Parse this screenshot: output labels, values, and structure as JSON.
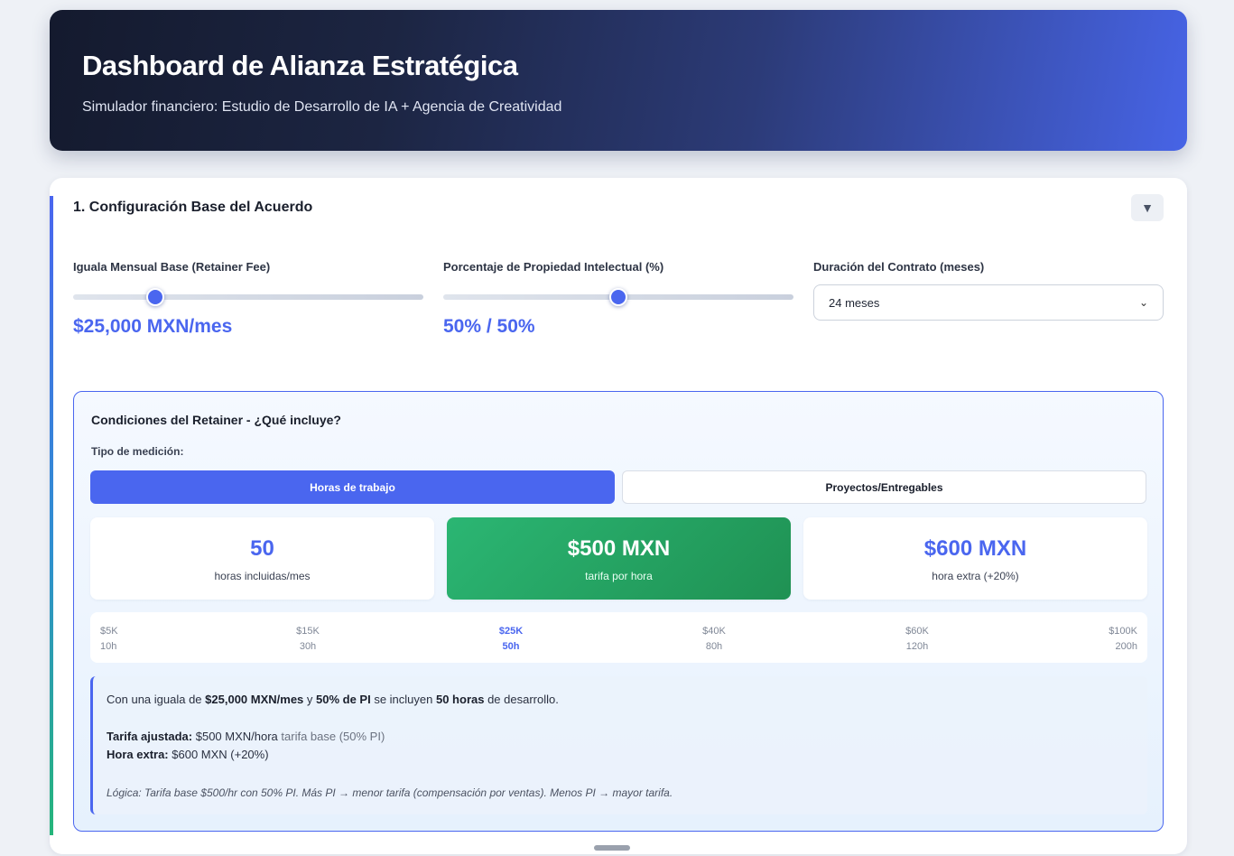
{
  "header": {
    "title": "Dashboard de Alianza Estratégica",
    "subtitle": "Simulador financiero: Estudio de Desarrollo de IA + Agencia de Creatividad"
  },
  "section": {
    "title": "1. Configuración Base del Acuerdo",
    "toggle_icon": "▼",
    "toggle": "collapse-toggle-icon"
  },
  "retainer": {
    "label": "Iguala Mensual Base (Retainer Fee)",
    "value": "$25,000 MXN/mes",
    "slider_fraction": 0.22
  },
  "ip": {
    "label": "Porcentaje de Propiedad Intelectual (%)",
    "value": "50% / 50%",
    "slider_fraction": 0.5
  },
  "duration": {
    "label": "Duración del Contrato (meses)",
    "selected": "24 meses",
    "chevron": "⌄"
  },
  "conditions": {
    "title": "Condiciones del Retainer - ¿Qué incluye?",
    "measure_label": "Tipo de medición:",
    "tabs": [
      {
        "label": "Horas de trabajo",
        "active": true
      },
      {
        "label": "Proyectos/Entregables",
        "active": false
      }
    ],
    "stats": [
      {
        "value": "50",
        "caption": "horas incluidas/mes"
      },
      {
        "value": "$500 MXN",
        "caption": "tarifa por hora"
      },
      {
        "value": "$600 MXN",
        "caption": "hora extra (+20%)"
      }
    ],
    "tiers": [
      {
        "price": "$5K",
        "hours": "10h"
      },
      {
        "price": "$15K",
        "hours": "30h"
      },
      {
        "price": "$25K",
        "hours": "50h",
        "active": true
      },
      {
        "price": "$40K",
        "hours": "80h"
      },
      {
        "price": "$60K",
        "hours": "120h"
      },
      {
        "price": "$100K",
        "hours": "200h"
      }
    ],
    "info": {
      "l1_a": "Con una iguala de ",
      "l1_b": "$25,000 MXN/mes",
      "l1_c": " y ",
      "l1_d": "50% de PI",
      "l1_e": " se incluyen ",
      "l1_f": "50 horas",
      "l1_g": " de desarrollo.",
      "l2_label": "Tarifa ajustada:",
      "l2_value": " $500 MXN/hora",
      "l2_note": " tarifa base (50% PI)",
      "l3_label": "Hora extra:",
      "l3_value": " $600 MXN (+20%)",
      "logic": "Lógica: Tarifa base $500/hr con 50% PI. Más PI → menor tarifa (compensación por ventas). Menos PI → mayor tarifa."
    }
  },
  "colors": {
    "accent": "#4a66ef",
    "green": "#2bb673",
    "header_dark": "#141a2e"
  }
}
